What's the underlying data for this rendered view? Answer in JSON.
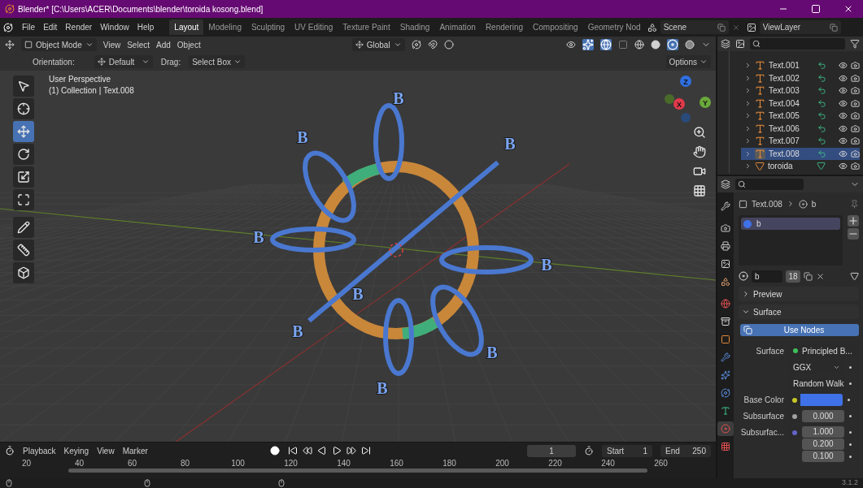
{
  "window": {
    "title": "Blender* [C:\\Users\\ACER\\Documents\\blender\\toroida kosong.blend]"
  },
  "menu": [
    "File",
    "Edit",
    "Render",
    "Window",
    "Help"
  ],
  "workspaces": [
    {
      "label": "Layout",
      "selected": true
    },
    {
      "label": "Modeling",
      "selected": false
    },
    {
      "label": "Sculpting",
      "selected": false
    },
    {
      "label": "UV Editing",
      "selected": false
    },
    {
      "label": "Texture Paint",
      "selected": false
    },
    {
      "label": "Shading",
      "selected": false
    },
    {
      "label": "Animation",
      "selected": false
    },
    {
      "label": "Rendering",
      "selected": false
    },
    {
      "label": "Compositing",
      "selected": false
    },
    {
      "label": "Geometry Nod",
      "selected": false
    }
  ],
  "scene": "Scene",
  "view_layer": "ViewLayer",
  "viewport_header": {
    "mode": "Object Mode",
    "menus": [
      "View",
      "Select",
      "Add",
      "Object"
    ],
    "orientation": "Global"
  },
  "tool_settings": {
    "orientation_label": "Orientation:",
    "orientation": "Default",
    "drag_label": "Drag:",
    "drag": "Select Box",
    "options": "Options"
  },
  "tools": [
    {
      "kind": "select",
      "selected": false
    },
    {
      "kind": "cursor",
      "selected": false
    },
    {
      "kind": "move",
      "selected": true
    },
    {
      "kind": "rotate",
      "selected": false
    },
    {
      "kind": "scale",
      "selected": false
    },
    {
      "kind": "transform",
      "selected": false
    },
    {
      "kind": "annotate",
      "selected": false
    },
    {
      "kind": "measure",
      "selected": false
    },
    {
      "kind": "add-cube",
      "selected": false
    }
  ],
  "overlay": [
    "User Perspective",
    "(1) Collection | Text.008"
  ],
  "scene_labels": [
    "B",
    "B",
    "B",
    "B",
    "B",
    "B",
    "B",
    "B",
    "B"
  ],
  "gizmo": [
    "Z",
    "X",
    "Y"
  ],
  "timeline": {
    "menus": [
      "Playback",
      "Keying",
      "View",
      "Marker"
    ],
    "frame": "1",
    "start_label": "Start",
    "start": "1",
    "end_label": "End",
    "end": "250",
    "ticks": [
      "20",
      "40",
      "60",
      "80",
      "100",
      "120",
      "140",
      "160",
      "180",
      "200",
      "220",
      "240",
      "260"
    ]
  },
  "outliner": [
    {
      "name": "Text.001",
      "kind": "text",
      "selected": false
    },
    {
      "name": "Text.002",
      "kind": "text",
      "selected": false
    },
    {
      "name": "Text.003",
      "kind": "text",
      "selected": false
    },
    {
      "name": "Text.004",
      "kind": "text",
      "selected": false
    },
    {
      "name": "Text.005",
      "kind": "text",
      "selected": false
    },
    {
      "name": "Text.006",
      "kind": "text",
      "selected": false
    },
    {
      "name": "Text.007",
      "kind": "text",
      "selected": false
    },
    {
      "name": "Text.008",
      "kind": "text",
      "selected": true
    },
    {
      "name": "toroida",
      "kind": "mesh",
      "selected": false
    }
  ],
  "properties": {
    "tabs": [
      {
        "kind": "tool",
        "selected": false
      },
      {
        "kind": "render",
        "selected": false
      },
      {
        "kind": "output",
        "selected": false
      },
      {
        "kind": "view-layer",
        "selected": false
      },
      {
        "kind": "scene",
        "selected": false
      },
      {
        "kind": "world",
        "selected": false
      },
      {
        "kind": "collection",
        "selected": false
      },
      {
        "kind": "object",
        "selected": false
      },
      {
        "kind": "modifiers",
        "selected": false
      },
      {
        "kind": "particles",
        "selected": false
      },
      {
        "kind": "physics",
        "selected": false
      },
      {
        "kind": "data",
        "selected": false
      },
      {
        "kind": "material",
        "selected": true
      },
      {
        "kind": "texture",
        "selected": false
      }
    ],
    "breadcrumb": [
      "Text.008",
      "b"
    ],
    "slots": [
      {
        "name": "b",
        "selected": true
      }
    ],
    "material": {
      "name": "b",
      "users": "18"
    },
    "panels": [
      {
        "title": "Preview",
        "expanded": false
      },
      {
        "title": "Surface",
        "expanded": true
      }
    ],
    "use_nodes": "Use Nodes",
    "fields": [
      {
        "kind": "link",
        "label": "Surface",
        "value": "Principled B...",
        "color": "#3fbf5a"
      },
      {
        "kind": "dropdown",
        "value": "GGX"
      },
      {
        "kind": "dropdown",
        "value": "Random Walk"
      },
      {
        "kind": "color",
        "label": "Base Color",
        "color": "#c7c729",
        "swatch": {
          "color": "#3f72e8"
        }
      },
      {
        "kind": "number",
        "label": "Subsurface",
        "value": "0.000",
        "color": "#a1a1a1"
      },
      {
        "kind": "vector",
        "label": "Subsurfac...",
        "values": [
          "1.000",
          "0.200",
          "0.100"
        ],
        "color": "#6363c7"
      }
    ]
  },
  "status": {
    "version": "3.1.2"
  }
}
